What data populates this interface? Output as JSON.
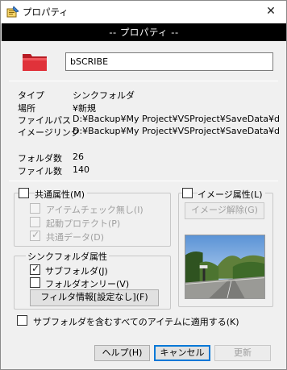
{
  "window": {
    "title": "プロパティ",
    "close_glyph": "✕"
  },
  "banner": {
    "text": "-- プロパティ --"
  },
  "name_field": {
    "value": "bSCRIBE"
  },
  "info": [
    {
      "label": "タイプ",
      "value": "シンクフォルダ"
    },
    {
      "label": "場所",
      "value": "¥新規"
    },
    {
      "label": "ファイルパス",
      "value": "D:¥Backup¥My Project¥VSProject¥SaveData¥dIN"
    },
    {
      "label": "イメージリンク",
      "value": "D:¥Backup¥My Project¥VSProject¥SaveData¥dIN"
    }
  ],
  "counts": [
    {
      "label": "フォルダ数",
      "value": "26"
    },
    {
      "label": "ファイル数",
      "value": "140"
    }
  ],
  "common_attr": {
    "label": "共通属性(M)",
    "checked": false,
    "options": [
      {
        "label": "アイテムチェック無し(I)",
        "checked": false,
        "enabled": false
      },
      {
        "label": "起動プロテクト(P)",
        "checked": false,
        "enabled": false
      },
      {
        "label": "共通データ(D)",
        "checked": true,
        "enabled": false
      }
    ]
  },
  "image_attr": {
    "label": "イメージ属性(L)",
    "checked": false,
    "release_button": "イメージ解除(G)"
  },
  "sync_attr": {
    "legend": "シンクフォルダ属性",
    "options": [
      {
        "label": "サブフォルダ(J)",
        "checked": true
      },
      {
        "label": "フォルダオンリー(V)",
        "checked": false
      }
    ],
    "filter_button": "フィルタ情報[設定なし](F)"
  },
  "apply_all": {
    "label": "サブフォルダを含むすべてのアイテムに適用する(K)",
    "checked": false
  },
  "buttons": {
    "help": "ヘルプ(H)",
    "cancel": "キャンセル",
    "update": "更新"
  },
  "colors": {
    "banner_bg": "#000000",
    "folder_red": "#d9242f",
    "primary_border": "#0078d7"
  }
}
